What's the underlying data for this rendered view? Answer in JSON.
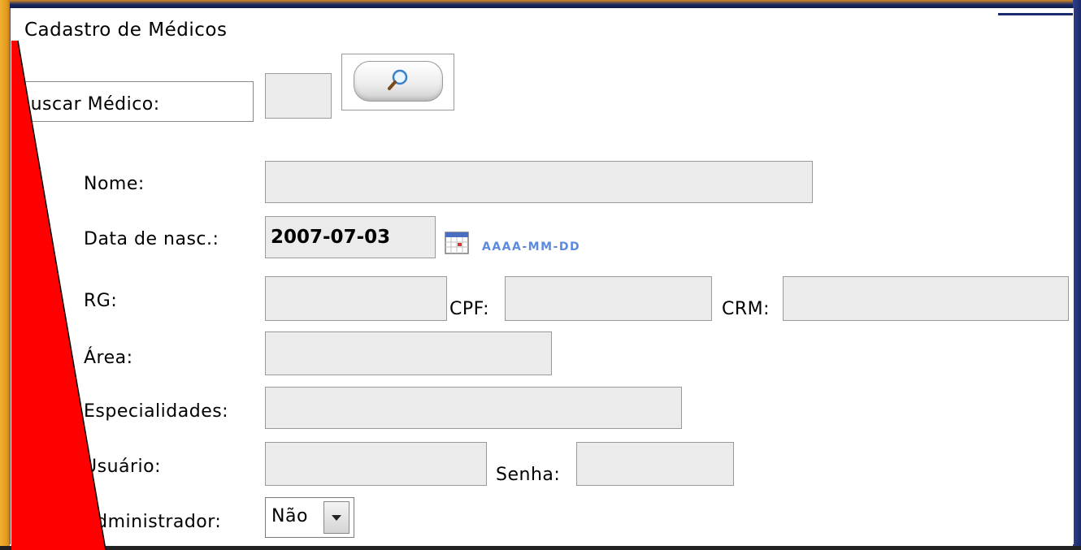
{
  "form": {
    "title": "Cadastro de Médicos",
    "search": {
      "label": "Buscar Médico:",
      "value": "",
      "button_icon": "magnifier-icon"
    },
    "fields": {
      "nome": {
        "label": "Nome:",
        "value": ""
      },
      "data_nasc": {
        "label": "Data de nasc.:",
        "value": "2007-07-03",
        "hint": "AAAA-MM-DD",
        "icon": "calendar-icon"
      },
      "rg": {
        "label": "RG:",
        "value": ""
      },
      "cpf": {
        "label": "CPF:",
        "value": ""
      },
      "crm": {
        "label": "CRM:",
        "value": ""
      },
      "area": {
        "label": "Área:",
        "value": ""
      },
      "especialidades": {
        "label": "Especialidades:",
        "value": ""
      },
      "usuario": {
        "label": "Usuário:",
        "value": ""
      },
      "senha": {
        "label": "Senha:",
        "value": ""
      },
      "administrador": {
        "label": "Administrador:",
        "value": "Não"
      }
    }
  },
  "colors": {
    "field_bg": "#ebebeb",
    "hint": "#5b8ae0",
    "wedge": "#ff0000",
    "frame_left": "#e39a1c",
    "frame_top": "#1c2a63"
  }
}
